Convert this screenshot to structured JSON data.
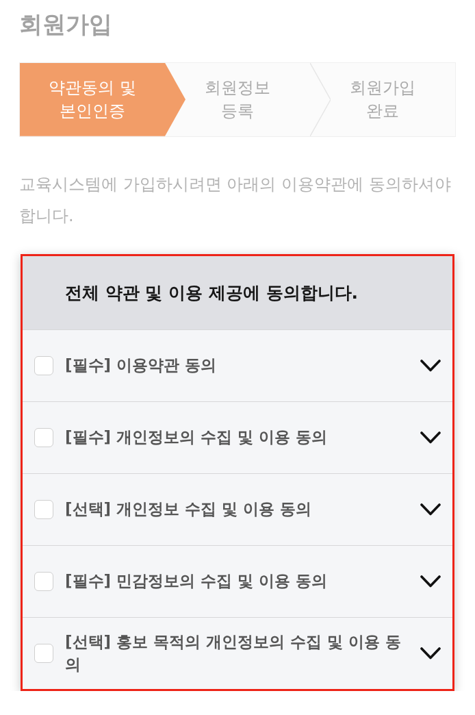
{
  "page": {
    "title": "회원가입"
  },
  "steps": [
    {
      "label": "약관동의 및 본인인증",
      "selected": true
    },
    {
      "label": "회원정보 등록",
      "selected": false
    },
    {
      "label": "회원가입 완료",
      "selected": false
    }
  ],
  "intro": "교육시스템에 가입하시려면 아래의 이용약관에 동의하셔야 합니다.",
  "terms_panel": {
    "header": "전체 약관 및 이용 제공에 동의합니다.",
    "items": [
      {
        "label": "[필수] 이용약관 동의",
        "checked": false,
        "expanded": false
      },
      {
        "label": "[필수] 개인정보의 수집 및 이용 동의",
        "checked": false,
        "expanded": false
      },
      {
        "label": "[선택] 개인정보 수집 및 이용 동의",
        "checked": false,
        "expanded": false
      },
      {
        "label": "[필수] 민감정보의 수집 및 이용 동의",
        "checked": false,
        "expanded": false
      },
      {
        "label": "[선택] 홍보 목적의 개인정보의 수집 및 이용 동의",
        "checked": false,
        "expanded": false
      }
    ]
  }
}
